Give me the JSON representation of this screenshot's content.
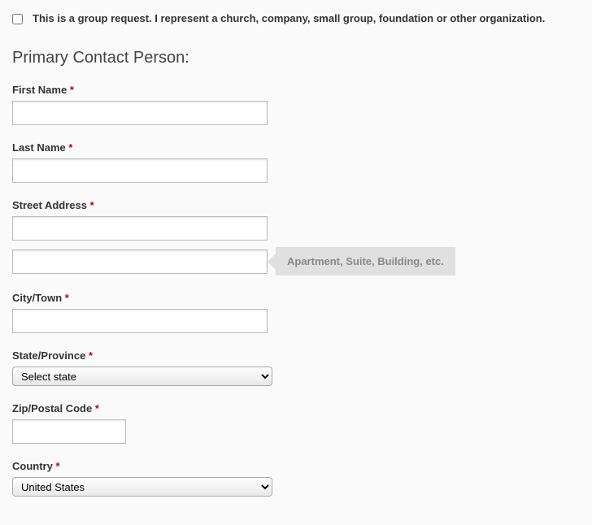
{
  "group_request": {
    "label": "This is a group request. I represent a church, company, small group, foundation or other organization."
  },
  "section_title": "Primary Contact Person:",
  "fields": {
    "first_name": {
      "label": "First Name",
      "value": ""
    },
    "last_name": {
      "label": "Last Name",
      "value": ""
    },
    "street_address": {
      "label": "Street Address",
      "value1": "",
      "value2": "",
      "hint": "Apartment, Suite, Building, etc."
    },
    "city": {
      "label": "City/Town",
      "value": ""
    },
    "state": {
      "label": "State/Province",
      "placeholder": "Select state"
    },
    "zip": {
      "label": "Zip/Postal Code",
      "value": ""
    },
    "country": {
      "label": "Country",
      "selected": "United States"
    }
  },
  "required_marker": "*"
}
